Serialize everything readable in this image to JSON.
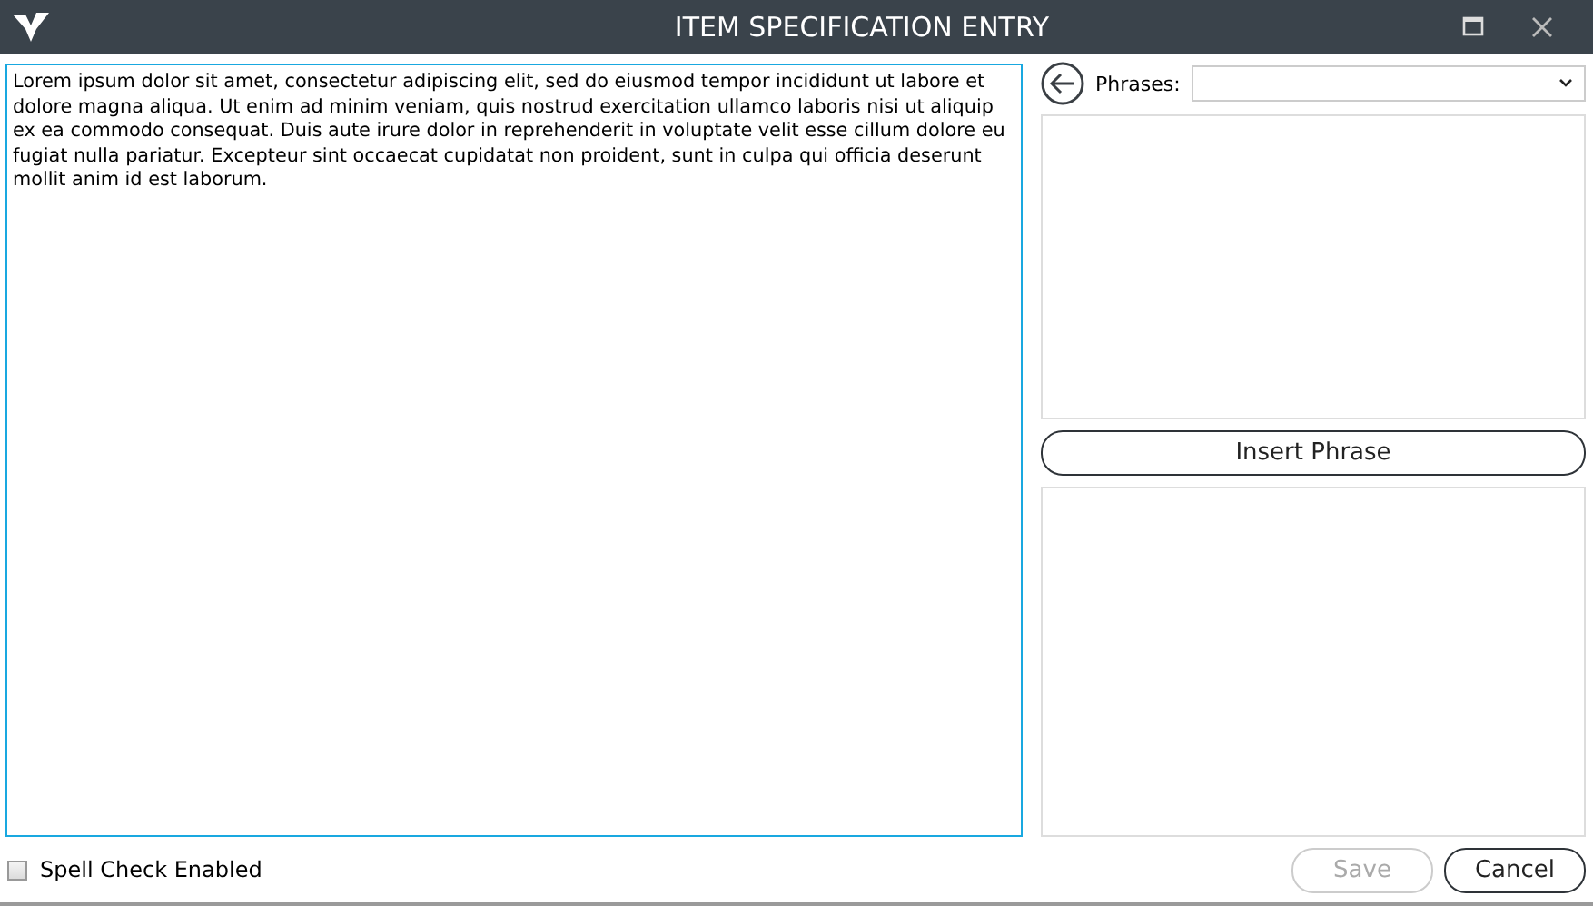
{
  "window": {
    "title": "ITEM SPECIFICATION ENTRY"
  },
  "text_editor": {
    "value": "Lorem ipsum dolor sit amet, consectetur adipiscing elit, sed do eiusmod tempor incididunt ut labore et dolore magna aliqua. Ut enim ad minim veniam, quis nostrud exercitation ullamco laboris nisi ut aliquip ex ea commodo consequat. Duis aute irure dolor in reprehenderit in voluptate velit esse cillum dolore eu fugiat nulla pariatur. Excepteur sint occaecat cupidatat non proident, sunt in culpa qui officia deserunt mollit anim id est laborum."
  },
  "phrases": {
    "label": "Phrases:"
  },
  "insert_button": {
    "label": "Insert Phrase"
  },
  "spell_check": {
    "label": "Spell Check Enabled",
    "checked": false
  },
  "buttons": [
    {
      "label": "Save",
      "disabled": true
    },
    {
      "label": "Cancel",
      "disabled": false
    }
  ]
}
